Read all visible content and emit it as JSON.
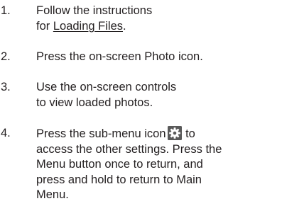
{
  "steps": [
    {
      "number": "1.",
      "lines": [
        "Follow the instructions"
      ],
      "line2_prefix": "for ",
      "line2_link": "Loading Files",
      "line2_suffix": "."
    },
    {
      "number": "2.",
      "lines": [
        "Press the on-screen Photo icon."
      ]
    },
    {
      "number": "3.",
      "lines": [
        "Use the on-screen controls",
        "to view loaded photos."
      ]
    },
    {
      "number": "4.",
      "line1_before_icon": "Press the sub-menu icon",
      "line1_after_icon": " to",
      "lines": [
        "access the other settings. Press the",
        "Menu button once to return, and",
        "press and hold to return to Main",
        "Menu."
      ],
      "icon": "gear-submenu-icon"
    }
  ],
  "colors": {
    "text": "#231f20",
    "icon_bg": "#5a5a5a"
  }
}
